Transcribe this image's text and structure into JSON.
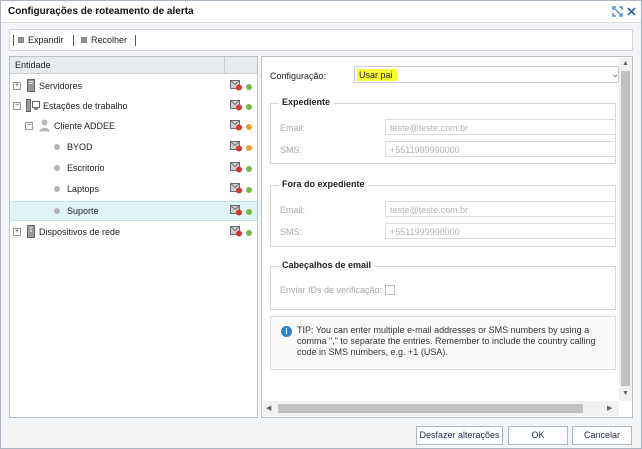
{
  "window": {
    "title": "Configurações de roteamento de alerta",
    "maximize_icon": "maximize-icon",
    "close_icon": "close-icon"
  },
  "toolbar": {
    "expand_label": "Expandir",
    "collapse_label": "Recolher"
  },
  "tree": {
    "header": "Entidade",
    "items": [
      {
        "label": "Servidores",
        "icon": "server-icon",
        "status": "green",
        "expanded": false
      },
      {
        "label": "Estações de trabalho",
        "icon": "workstation-icon",
        "status": "green",
        "expanded": true
      },
      {
        "label": "Cliente ADDEE",
        "icon": "user-icon",
        "status": "orange",
        "expanded": true
      },
      {
        "label": "BYOD",
        "icon": "leaf-dot-icon",
        "status": "orange"
      },
      {
        "label": "Escritorio",
        "icon": "leaf-dot-icon",
        "status": "green"
      },
      {
        "label": "Laptops",
        "icon": "leaf-dot-icon",
        "status": "green"
      },
      {
        "label": "Suporte",
        "icon": "leaf-dot-icon",
        "status": "green",
        "selected": true
      },
      {
        "label": "Dispositivos de rede",
        "icon": "network-device-icon",
        "status": "green",
        "expanded": false
      }
    ]
  },
  "config": {
    "label": "Configuração:",
    "value": "Usar pai",
    "work_hours": {
      "legend": "Expediente",
      "email_label": "Email:",
      "email_value": "teste@teste.com.br",
      "sms_label": "SMS:",
      "sms_value": "+5511999990000"
    },
    "off_hours": {
      "legend": "Fora do expediente",
      "email_label": "Email:",
      "email_value": "teste@teste.com.br",
      "sms_label": "SMS:",
      "sms_value": "+5511999990000"
    },
    "email_headers": {
      "legend": "Cabeçalhos de email",
      "send_ids_label": "Enviar IDs de verificação:"
    },
    "tip": "TIP: You can enter multiple e-mail addresses or SMS numbers by using a comma \",\" to separate the entries. Remember to include the country calling code in SMS numbers, e.g. +1 (USA)."
  },
  "buttons": {
    "undo": "Desfazer alterações",
    "ok": "OK",
    "cancel": "Cancelar"
  },
  "colors": {
    "status_green": "#7ab648",
    "status_orange": "#f0a030",
    "highlight": "#fcfc34",
    "selected_row": "#dff4f6",
    "info": "#2e86c9"
  }
}
